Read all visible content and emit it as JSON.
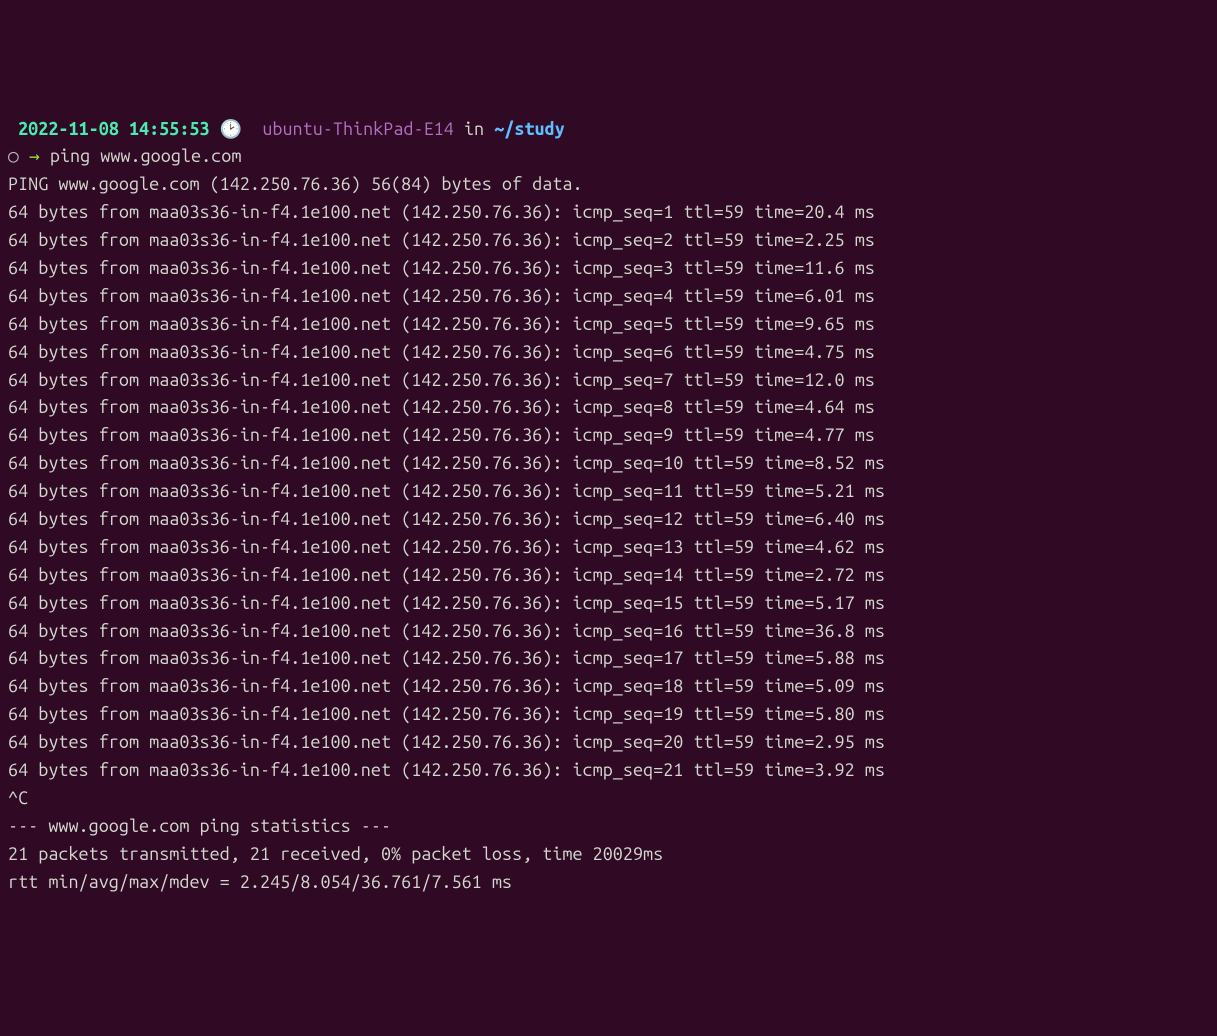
{
  "prompt": {
    "timestamp": "2022-11-08 14:55:53",
    "clock": "🕑",
    "hostname": "ubuntu-ThinkPad-E14",
    "in_text": "in",
    "path": "~/study",
    "circle": "○",
    "arrow": "→",
    "command": "ping www.google.com"
  },
  "header": "PING www.google.com (142.250.76.36) 56(84) bytes of data.",
  "ping_host": "maa03s36-in-f4.1e100.net",
  "ping_ip": "142.250.76.36",
  "ping_bytes": 64,
  "ping_ttl": 59,
  "ping_rows": [
    {
      "seq": 1,
      "time": "20.4"
    },
    {
      "seq": 2,
      "time": "2.25"
    },
    {
      "seq": 3,
      "time": "11.6"
    },
    {
      "seq": 4,
      "time": "6.01"
    },
    {
      "seq": 5,
      "time": "9.65"
    },
    {
      "seq": 6,
      "time": "4.75"
    },
    {
      "seq": 7,
      "time": "12.0"
    },
    {
      "seq": 8,
      "time": "4.64"
    },
    {
      "seq": 9,
      "time": "4.77"
    },
    {
      "seq": 10,
      "time": "8.52"
    },
    {
      "seq": 11,
      "time": "5.21"
    },
    {
      "seq": 12,
      "time": "6.40"
    },
    {
      "seq": 13,
      "time": "4.62"
    },
    {
      "seq": 14,
      "time": "2.72"
    },
    {
      "seq": 15,
      "time": "5.17"
    },
    {
      "seq": 16,
      "time": "36.8"
    },
    {
      "seq": 17,
      "time": "5.88"
    },
    {
      "seq": 18,
      "time": "5.09"
    },
    {
      "seq": 19,
      "time": "5.80"
    },
    {
      "seq": 20,
      "time": "2.95"
    },
    {
      "seq": 21,
      "time": "3.92"
    }
  ],
  "interrupt": "^C",
  "stats_header": "--- www.google.com ping statistics ---",
  "stats_line1": "21 packets transmitted, 21 received, 0% packet loss, time 20029ms",
  "stats_line2": "rtt min/avg/max/mdev = 2.245/8.054/36.761/7.561 ms"
}
